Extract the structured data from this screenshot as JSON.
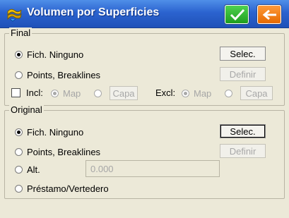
{
  "window": {
    "title": "Volumen por Superficies",
    "icon": "surface-volume-icon",
    "ok_icon": "checkmark-icon",
    "back_icon": "back-arrow-icon"
  },
  "final": {
    "legend": "Final",
    "options": [
      {
        "label": "Fich. Ninguno",
        "selected": true
      },
      {
        "label": "Points, Breaklines",
        "selected": false
      }
    ],
    "select_button": "Selec.",
    "define_button": "Definir",
    "incl": {
      "label": "Incl:",
      "checked": false,
      "map_label": "Map",
      "capa_button": "Capa"
    },
    "excl": {
      "label": "Excl:",
      "map_label": "Map",
      "capa_button": "Capa"
    }
  },
  "original": {
    "legend": "Original",
    "options": [
      {
        "label": "Fich. Ninguno",
        "selected": true
      },
      {
        "label": "Points, Breaklines",
        "selected": false
      },
      {
        "label": "Alt.",
        "selected": false
      },
      {
        "label": "Préstamo/Vertedero",
        "selected": false
      }
    ],
    "select_button": "Selec.",
    "define_button": "Definir",
    "alt_value": "0.000"
  },
  "colors": {
    "title_bar": "#2b63cf",
    "ok_button": "#1e9e1e",
    "back_button": "#e66a00",
    "background": "#ece9d8"
  }
}
